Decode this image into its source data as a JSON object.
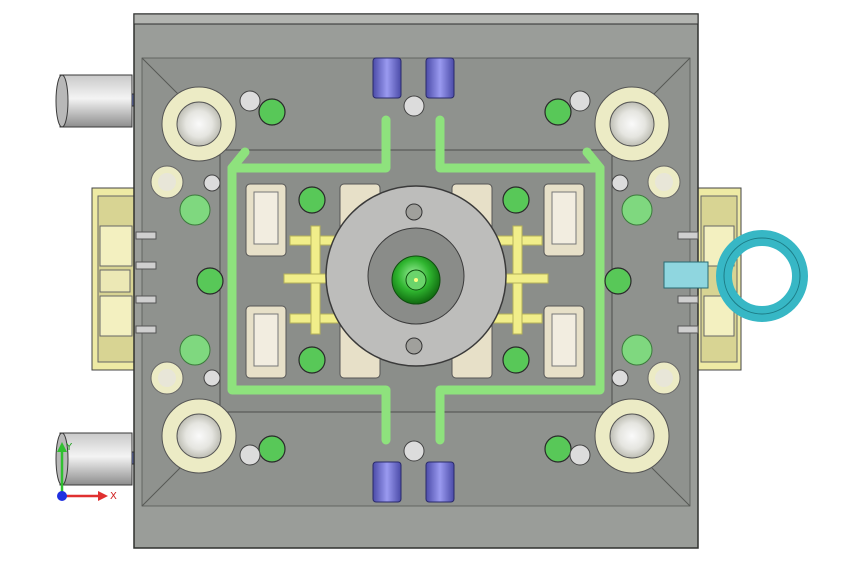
{
  "view": {
    "type": "cad-3d-viewport",
    "model": "injection-mold-assembly-top-view",
    "background": "#ffffff"
  },
  "colors": {
    "plate_fill": "#9a9d99",
    "plate_edge": "#2f302e",
    "cooling_line": "#8ee27d",
    "ejector_runner": "#f1ee8a",
    "nozzle": "#2fb52f",
    "fittings": "#6a6ad0",
    "eyebolt": "#37b7c5",
    "guide_bushing": "#ecebc5",
    "side_block": "#eeeaa4",
    "sprue_bushing": "#bdbdbb",
    "cavity_insert": "#e7e0c8"
  },
  "triad": {
    "x_label": "X",
    "y_label": "Y",
    "x_color": "#e03030",
    "y_color": "#30c030",
    "z_color": "#2030e0"
  }
}
